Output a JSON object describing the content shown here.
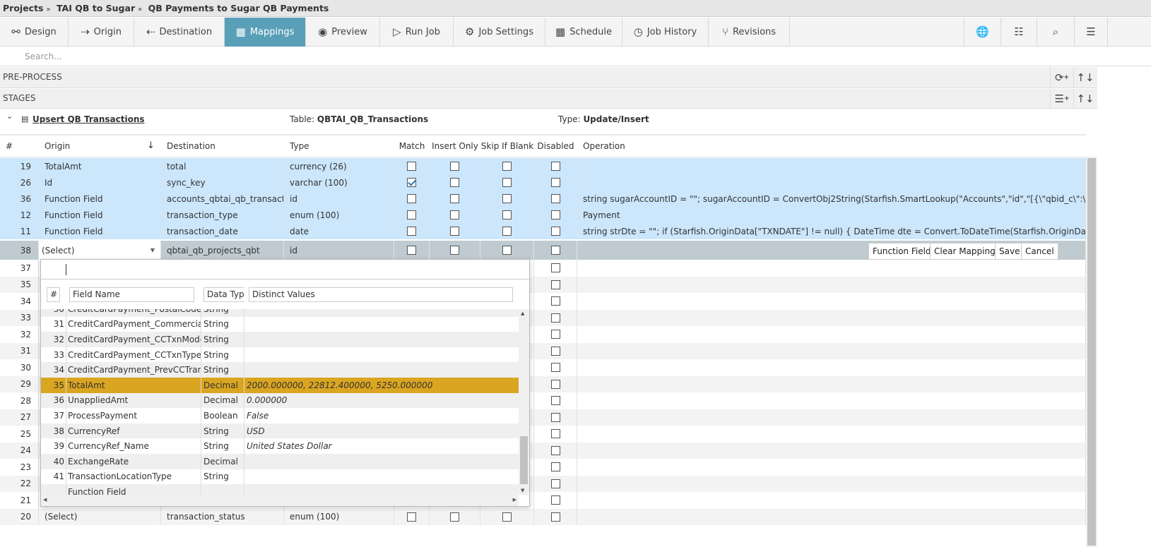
{
  "breadcrumb": [
    "Projects",
    "TAI QB to Sugar",
    "QB Payments to Sugar QB Payments"
  ],
  "toolbar": {
    "tabs": [
      {
        "label": "Design",
        "icon": "design-icon"
      },
      {
        "label": "Origin",
        "icon": "origin-icon"
      },
      {
        "label": "Destination",
        "icon": "destination-icon"
      },
      {
        "label": "Mappings",
        "icon": "grid-icon",
        "active": true
      },
      {
        "label": "Preview",
        "icon": "eye-icon"
      },
      {
        "label": "Run Job",
        "icon": "play-icon"
      },
      {
        "label": "Job Settings",
        "icon": "gear-icon"
      },
      {
        "label": "Schedule",
        "icon": "calendar-icon"
      },
      {
        "label": "Job History",
        "icon": "history-icon"
      },
      {
        "label": "Revisions",
        "icon": "branch-icon"
      }
    ],
    "right_icons": [
      "globe-icon",
      "checklist-icon",
      "log-search-icon",
      "task-list-icon"
    ]
  },
  "search": {
    "placeholder": "Search..."
  },
  "preprocess": {
    "label": "PRE-PROCESS"
  },
  "stages": {
    "label": "STAGES"
  },
  "stage": {
    "name": "Upsert QB Transactions",
    "table_label": "Table:",
    "table": "QBTAI_QB_Transactions",
    "type_label": "Type:",
    "type": "Update/Insert"
  },
  "columns": [
    "#",
    "Origin",
    "Destination",
    "Type",
    "Match",
    "Insert Only",
    "Skip If Blank",
    "Disabled",
    "Operation"
  ],
  "mapped_rows": [
    {
      "num": "19",
      "origin": "TotalAmt",
      "dest": "total",
      "type": "currency (26)",
      "match": false,
      "op": ""
    },
    {
      "num": "26",
      "origin": "Id",
      "dest": "sync_key",
      "type": "varchar (100)",
      "match": true,
      "op": ""
    },
    {
      "num": "36",
      "origin": "Function Field",
      "dest": "accounts_qbtai_qb_transactions",
      "type": "id",
      "match": false,
      "op": "string sugarAccountID = \"\"; sugarAccountID = ConvertObj2String(Starfish.SmartLookup(\"Accounts\",\"id\",\"[{\\\"qbid_c\\\":\\\"\"+ConvertObj2String(Starfish.OriginData[\"CUSTOMERREF\"]"
    },
    {
      "num": "12",
      "origin": "Function Field",
      "dest": "transaction_type",
      "type": "enum (100)",
      "match": false,
      "op": "Payment"
    },
    {
      "num": "11",
      "origin": "Function Field",
      "dest": "transaction_date",
      "type": "date",
      "match": false,
      "op": "string strDte = \"\"; if (Starfish.OriginData[\"TXNDATE\"] != null) { DateTime dte = Convert.ToDateTime(Starfish.OriginData[\"TXNDATE\"].ToString());"
    }
  ],
  "editing_row": {
    "num": "38",
    "origin": "(Select)",
    "dest": "qbtai_qb_projects_qbt",
    "type": "id",
    "buttons": [
      "Function Field",
      "Clear Mapping",
      "Save",
      "Cancel"
    ]
  },
  "other_rows": [
    {
      "num": "37"
    },
    {
      "num": "35"
    },
    {
      "num": "34"
    },
    {
      "num": "33"
    },
    {
      "num": "32"
    },
    {
      "num": "31"
    },
    {
      "num": "30"
    },
    {
      "num": "29"
    },
    {
      "num": "28"
    },
    {
      "num": "27"
    },
    {
      "num": "25"
    },
    {
      "num": "24"
    },
    {
      "num": "23"
    },
    {
      "num": "22"
    },
    {
      "num": "21"
    },
    {
      "num": "20",
      "origin": "(Select)",
      "dest": "transaction_status",
      "type": "enum (100)"
    }
  ],
  "dropdown": {
    "search_value": "",
    "headers": [
      "#",
      "Field Name",
      "Data Type",
      "Distinct Values"
    ],
    "items": [
      {
        "num": "30",
        "name": "CreditCardPayment_PostalCode",
        "type": "String",
        "values": ""
      },
      {
        "num": "31",
        "name": "CreditCardPayment_CommercialCardCode",
        "type": "String",
        "values": ""
      },
      {
        "num": "32",
        "name": "CreditCardPayment_CCTxnMode",
        "type": "String",
        "values": ""
      },
      {
        "num": "33",
        "name": "CreditCardPayment_CCTxnType",
        "type": "String",
        "values": ""
      },
      {
        "num": "34",
        "name": "CreditCardPayment_PrevCCTransId",
        "type": "String",
        "values": ""
      },
      {
        "num": "35",
        "name": "TotalAmt",
        "type": "Decimal",
        "values": "2000.000000, 22812.400000, 5250.000000",
        "selected": true
      },
      {
        "num": "36",
        "name": "UnappliedAmt",
        "type": "Decimal",
        "values": "0.000000"
      },
      {
        "num": "37",
        "name": "ProcessPayment",
        "type": "Boolean",
        "values": "False"
      },
      {
        "num": "38",
        "name": "CurrencyRef",
        "type": "String",
        "values": "USD"
      },
      {
        "num": "39",
        "name": "CurrencyRef_Name",
        "type": "String",
        "values": "United States Dollar"
      },
      {
        "num": "40",
        "name": "ExchangeRate",
        "type": "Decimal",
        "values": ""
      },
      {
        "num": "41",
        "name": "TransactionLocationType",
        "type": "String",
        "values": ""
      },
      {
        "num": "",
        "name": "Function Field",
        "type": "",
        "values": ""
      }
    ]
  },
  "colors": {
    "active_tab": "#5a9fb8",
    "mapped_row": "#cce6fb",
    "editing_row": "#bfcbd1",
    "selected_item": "#daa520"
  }
}
